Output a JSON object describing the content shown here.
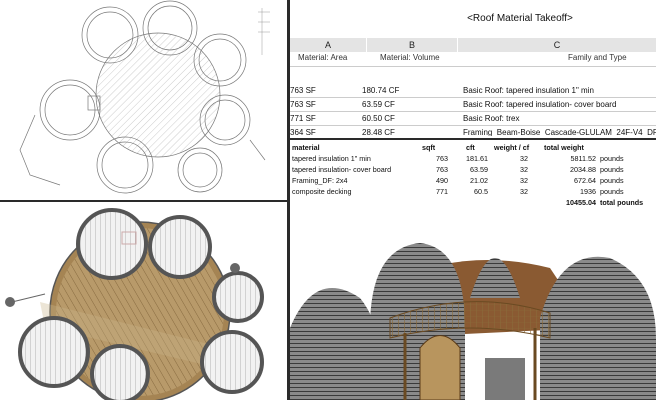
{
  "takeoff": {
    "title": "<Roof Material Takeoff>",
    "col_letters": [
      "A",
      "B",
      "C"
    ],
    "col_headers": [
      "Material: Area",
      "Material: Volume",
      "Family and Type"
    ],
    "rows": [
      {
        "area": "763 SF",
        "volume": "180.74 CF",
        "type": "Basic Roof: tapered insulation 1\" min"
      },
      {
        "area": "763 SF",
        "volume": "63.59 CF",
        "type": "Basic Roof: tapered insulation- cover board"
      },
      {
        "area": "771 SF",
        "volume": "60.50 CF",
        "type": "Basic Roof: trex"
      },
      {
        "area": "364 SF",
        "volume": "28.48 CF",
        "type": "Framing_Beam-Boise_Cascade-GLULAM_24F-V4_DF"
      }
    ]
  },
  "weights": {
    "headers": [
      "material",
      "sqft",
      "cft",
      "weight / cf",
      "total weight"
    ],
    "rows": [
      {
        "material": "tapered insulation 1\" min",
        "sqft": "763",
        "cft": "181.61",
        "wcf": "32",
        "total": "5811.52",
        "unit": "pounds"
      },
      {
        "material": "tapered insulation- cover board",
        "sqft": "763",
        "cft": "63.59",
        "wcf": "32",
        "total": "2034.88",
        "unit": "pounds"
      },
      {
        "material": "Framing_DF: 2x4",
        "sqft": "490",
        "cft": "21.02",
        "wcf": "32",
        "total": "672.64",
        "unit": "pounds"
      },
      {
        "material": "composite decking",
        "sqft": "771",
        "cft": "60.5",
        "wcf": "32",
        "total": "1936",
        "unit": "pounds"
      }
    ],
    "grand_total": "10455.04",
    "grand_total_label": "total pounds"
  },
  "colors": {
    "divider": "#2a2a2a",
    "header_bg": "#e4e4e4",
    "wood": "#b89a6a",
    "wall_gray": "#8a8a8a",
    "roof_brown": "#8a5a32"
  }
}
